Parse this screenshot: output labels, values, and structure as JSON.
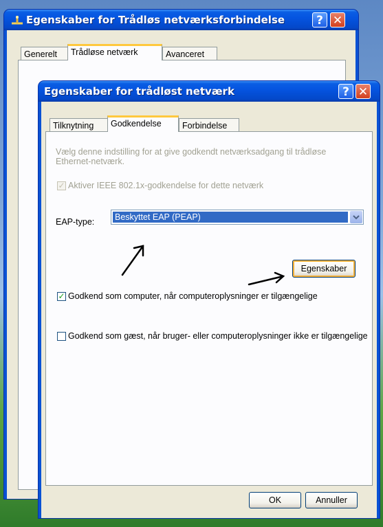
{
  "back_window": {
    "title": "Egenskaber for Trådløs netværksforbindelse",
    "tabs": [
      "Generelt",
      "Trådløse netværk",
      "Avanceret"
    ],
    "help_glyph": "?",
    "close_glyph": "✕"
  },
  "dialog": {
    "title": "Egenskaber for trådløst netværk",
    "help_glyph": "?",
    "close_glyph": "✕",
    "tabs": [
      "Tilknytning",
      "Godkendelse",
      "Forbindelse"
    ],
    "active_tab": "Godkendelse",
    "description": "Vælg denne indstilling for at give godkendt netværksadgang til trådløse Ethernet-netværk.",
    "enable_8021x": {
      "label": "Aktiver IEEE 802.1x-godkendelse for dette netværk",
      "checked": true,
      "enabled": false
    },
    "eap_type": {
      "label": "EAP-type:",
      "value": "Beskyttet EAP (PEAP)"
    },
    "properties_button": "Egenskaber",
    "auth_as_computer": {
      "label": "Godkend som computer, når computeroplysninger er tilgængelige",
      "checked": true
    },
    "auth_as_guest": {
      "label": "Godkend som gæst, når bruger- eller computeroplysninger ikke er tilgængelige",
      "checked": false
    },
    "ok_button": "OK",
    "cancel_button": "Annuller"
  },
  "icons": [
    "network-icon",
    "help-icon",
    "close-icon",
    "checkbox-check-icon",
    "dropdown-arrow-icon",
    "arrow-annotation-icon"
  ],
  "colors": {
    "titlebar": "#0554e0",
    "client": "#ece9d8",
    "tab_accent": "#ffc83c",
    "selection": "#316ac5"
  }
}
